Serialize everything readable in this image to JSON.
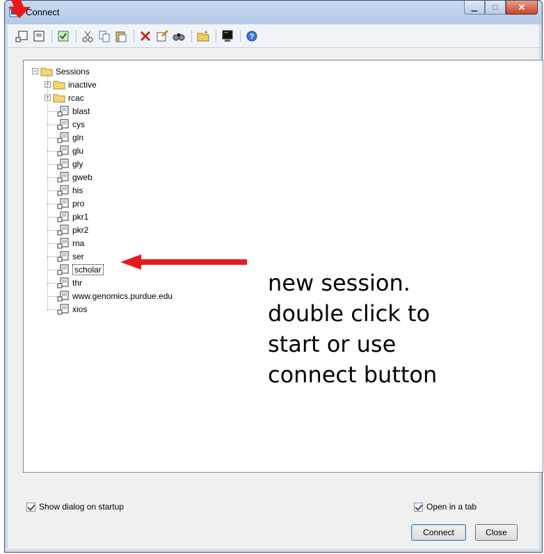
{
  "window": {
    "title": "Connect"
  },
  "toolbar": {
    "icons": [
      "new-session-icon",
      "new-session-alt-icon",
      "properties-icon",
      "cut-icon",
      "copy-icon",
      "paste-icon",
      "delete-icon",
      "rename-icon",
      "find-icon",
      "new-folder-icon",
      "terminal-icon",
      "help-icon"
    ]
  },
  "tree": {
    "root": "Sessions",
    "folders": [
      "inactive",
      "rcac"
    ],
    "sessions": [
      "blast",
      "cys",
      "gln",
      "glu",
      "gly",
      "gweb",
      "his",
      "pro",
      "pkr1",
      "pkr2",
      "rna",
      "ser",
      "scholar",
      "thr",
      "www.genomics.purdue.edu",
      "xios"
    ],
    "selected": "scholar"
  },
  "annotation": {
    "text": "new session.\ndouble click to\nstart or use\nconnect button",
    "arrow_color": "#e8191a"
  },
  "options": {
    "show_dialog_label": "Show dialog on startup",
    "show_dialog_checked": true,
    "open_in_tab_label": "Open in a tab",
    "open_in_tab_checked": true
  },
  "buttons": {
    "connect": "Connect",
    "close": "Close"
  }
}
